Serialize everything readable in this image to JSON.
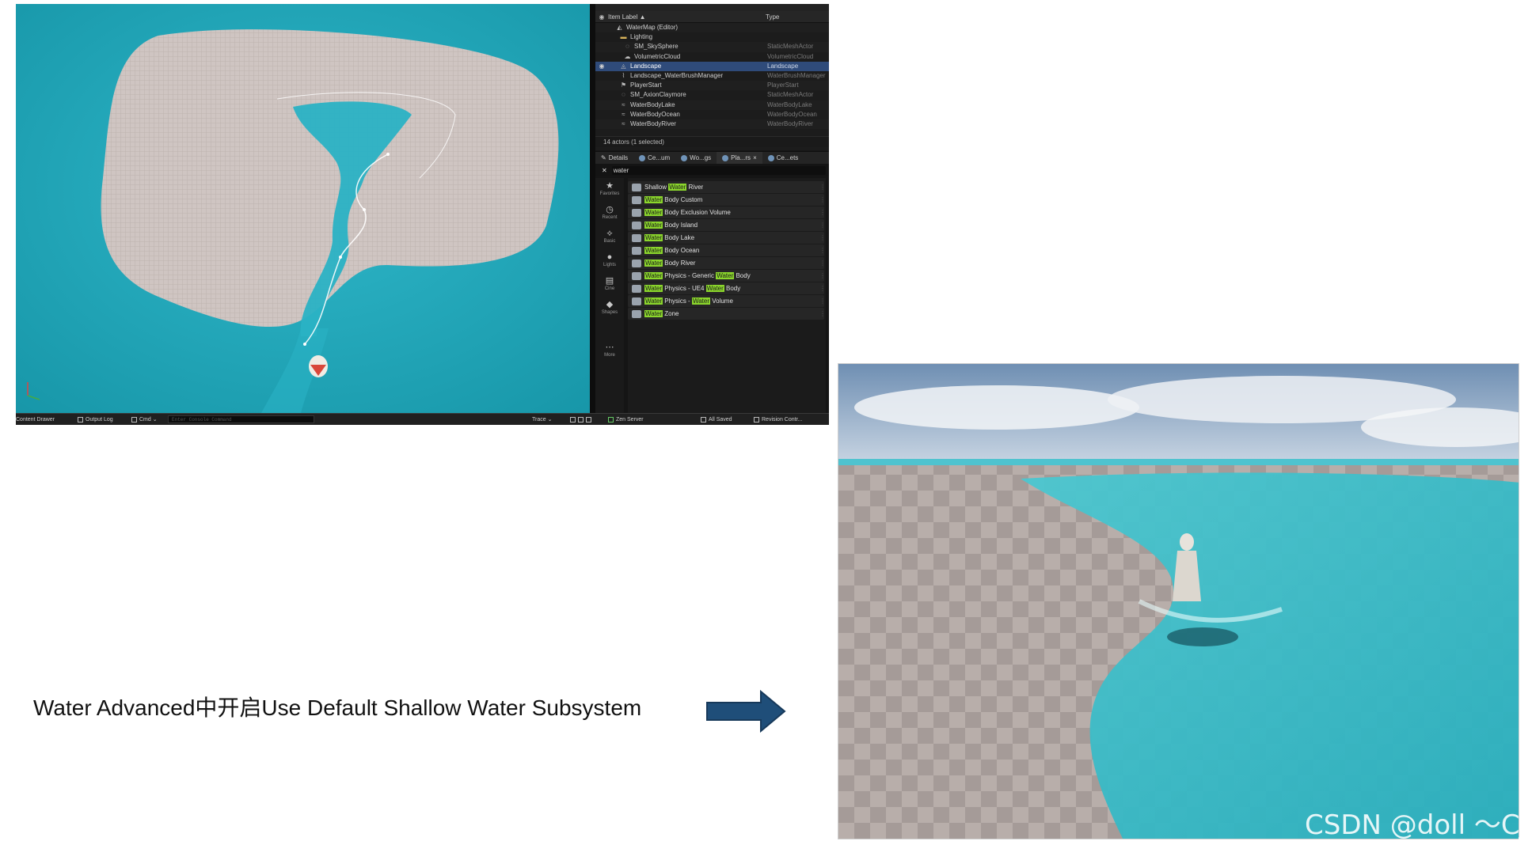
{
  "outliner": {
    "header": {
      "label": "Item Label ▲",
      "type": "Type"
    },
    "rows": [
      {
        "name": "WaterMap (Editor)",
        "type": "",
        "icon": "map-icon",
        "indent": 2
      },
      {
        "name": "Lighting",
        "type": "",
        "icon": "folder-icon",
        "indent": 3
      },
      {
        "name": "SM_SkySphere",
        "type": "StaticMeshActor",
        "icon": "mesh-icon",
        "indent": 4
      },
      {
        "name": "VolumetricCloud",
        "type": "VolumetricCloud",
        "icon": "cloud-icon",
        "indent": 4
      },
      {
        "name": "Landscape",
        "type": "Landscape",
        "icon": "landscape-icon",
        "indent": 3,
        "selected": true
      },
      {
        "name": "Landscape_WaterBrushManager",
        "type": "WaterBrushManager",
        "icon": "brush-icon",
        "indent": 3
      },
      {
        "name": "PlayerStart",
        "type": "PlayerStart",
        "icon": "flag-icon",
        "indent": 3
      },
      {
        "name": "SM_AxionClaymore",
        "type": "StaticMeshActor",
        "icon": "mesh-icon",
        "indent": 3
      },
      {
        "name": "WaterBodyLake",
        "type": "WaterBodyLake",
        "icon": "water-icon",
        "indent": 3
      },
      {
        "name": "WaterBodyOcean",
        "type": "WaterBodyOcean",
        "icon": "water-icon",
        "indent": 3
      },
      {
        "name": "WaterBodyRiver",
        "type": "WaterBodyRiver",
        "icon": "water-icon",
        "indent": 3
      }
    ],
    "count": "14 actors (1 selected)"
  },
  "tabs": [
    {
      "label": "Details",
      "active": false
    },
    {
      "label": "Ce...um",
      "active": false
    },
    {
      "label": "Wo...gs",
      "active": false
    },
    {
      "label": "Pla...rs",
      "active": true,
      "closable": "×"
    },
    {
      "label": "Ce...ets",
      "active": false
    }
  ],
  "search": {
    "value": "water",
    "clear": "✕"
  },
  "categories": [
    {
      "label": "Favorites",
      "icon": "star-icon"
    },
    {
      "label": "Recent",
      "icon": "clock-icon"
    },
    {
      "label": "Basic",
      "icon": "shapes-icon"
    },
    {
      "label": "Lights",
      "icon": "bulb-icon"
    },
    {
      "label": "Cine",
      "icon": "clapper-icon"
    },
    {
      "label": "Shapes",
      "icon": "cube-icon"
    },
    {
      "label": "More",
      "icon": "dots-icon"
    }
  ],
  "place_items": [
    {
      "parts": [
        [
          "Shallow ",
          false
        ],
        [
          "Water",
          true
        ],
        [
          " River",
          false
        ]
      ]
    },
    {
      "parts": [
        [
          "Water",
          true
        ],
        [
          " Body Custom",
          false
        ]
      ]
    },
    {
      "parts": [
        [
          "Water",
          true
        ],
        [
          " Body Exclusion Volume",
          false
        ]
      ]
    },
    {
      "parts": [
        [
          "Water",
          true
        ],
        [
          " Body Island",
          false
        ]
      ]
    },
    {
      "parts": [
        [
          "Water",
          true
        ],
        [
          " Body Lake",
          false
        ]
      ]
    },
    {
      "parts": [
        [
          "Water",
          true
        ],
        [
          " Body Ocean",
          false
        ]
      ]
    },
    {
      "parts": [
        [
          "Water",
          true
        ],
        [
          " Body River",
          false
        ]
      ]
    },
    {
      "parts": [
        [
          "Water",
          true
        ],
        [
          " Physics - Generic ",
          false
        ],
        [
          "Water",
          true
        ],
        [
          " Body",
          false
        ]
      ]
    },
    {
      "parts": [
        [
          "Water",
          true
        ],
        [
          " Physics - UE4 ",
          false
        ],
        [
          "Water",
          true
        ],
        [
          " Body",
          false
        ]
      ]
    },
    {
      "parts": [
        [
          "Water",
          true
        ],
        [
          " Physics - ",
          false
        ],
        [
          "Water",
          true
        ],
        [
          " Volume",
          false
        ]
      ]
    },
    {
      "parts": [
        [
          "Water",
          true
        ],
        [
          " Zone",
          false
        ]
      ]
    }
  ],
  "statusbar": {
    "content_drawer": "Content Drawer",
    "output_log": "Output Log",
    "cmd": "Cmd ⌄",
    "console_placeholder": "Enter Console Command",
    "trace": "Trace ⌄",
    "zen_server": "Zen Server",
    "all_saved": "All Saved",
    "revision_control": "Revision Contr..."
  },
  "caption": "Water Advanced中开启Use Default Shallow Water Subsystem",
  "watermark": "CSDN @doll ～CJ",
  "colors": {
    "highlight": "#8bd62c",
    "selected_row": "#2f4b7a",
    "water": "#1aa9bf",
    "arrow": "#1f4e79"
  }
}
